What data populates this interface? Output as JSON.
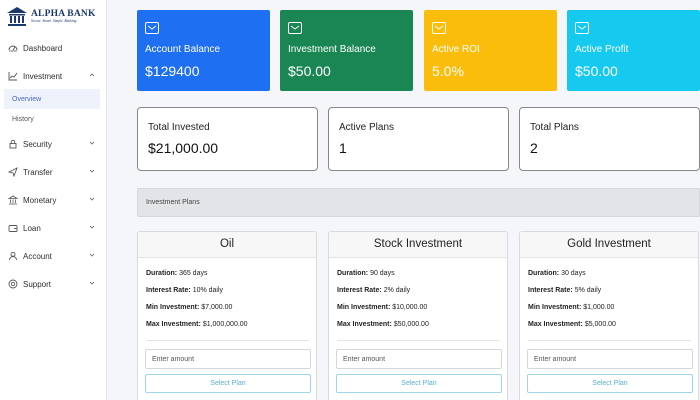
{
  "brand": {
    "name": "ALPHA BANK",
    "tagline": "Secure. Smart. Simple. Banking",
    "color": "#1b3a6b"
  },
  "sidebar": {
    "items": [
      {
        "label": "Dashboard",
        "icon": "dashboard-icon"
      },
      {
        "label": "Investment",
        "icon": "chart-line-icon",
        "expanded": true,
        "children": [
          {
            "label": "Overview",
            "active": true
          },
          {
            "label": "History"
          }
        ]
      },
      {
        "label": "Security",
        "icon": "lock-icon"
      },
      {
        "label": "Transfer",
        "icon": "send-icon"
      },
      {
        "label": "Monetary",
        "icon": "bank-icon"
      },
      {
        "label": "Loan",
        "icon": "wallet-icon"
      },
      {
        "label": "Account",
        "icon": "user-icon"
      },
      {
        "label": "Support",
        "icon": "support-icon"
      }
    ],
    "active_color": "#4a66c6"
  },
  "stats": [
    {
      "label": "Account Balance",
      "value": "$129400",
      "color": "#1e6ff1"
    },
    {
      "label": "Investment Balance",
      "value": "$50.00",
      "color": "#1a8653"
    },
    {
      "label": "Active ROI",
      "value": "5.0%",
      "color": "#fbbd0c"
    },
    {
      "label": "Active Profit",
      "value": "$50.00",
      "color": "#15c9ef"
    }
  ],
  "summary": [
    {
      "label": "Total Invested",
      "value": "$21,000.00"
    },
    {
      "label": "Active Plans",
      "value": "1"
    },
    {
      "label": "Total Plans",
      "value": "2"
    }
  ],
  "plans_section": {
    "title": "Investment Plans"
  },
  "plans": [
    {
      "name": "Oil",
      "duration": "365 days",
      "interest_rate": "10% daily",
      "min_investment": "$7,000.00",
      "max_investment": "$1,000,000.00"
    },
    {
      "name": "Stock Investment",
      "duration": "90 days",
      "interest_rate": "2% daily",
      "min_investment": "$10,000.00",
      "max_investment": "$50,000.00"
    },
    {
      "name": "Gold Investment",
      "duration": "30 days",
      "interest_rate": "5% daily",
      "min_investment": "$1,000.00",
      "max_investment": "$5,000.00"
    }
  ],
  "plan_labels": {
    "duration": "Duration:",
    "interest_rate": "Interest Rate:",
    "min_investment": "Min Investment:",
    "max_investment": "Max Investment:",
    "amount_placeholder": "Enter amount",
    "select_button": "Select Plan"
  }
}
